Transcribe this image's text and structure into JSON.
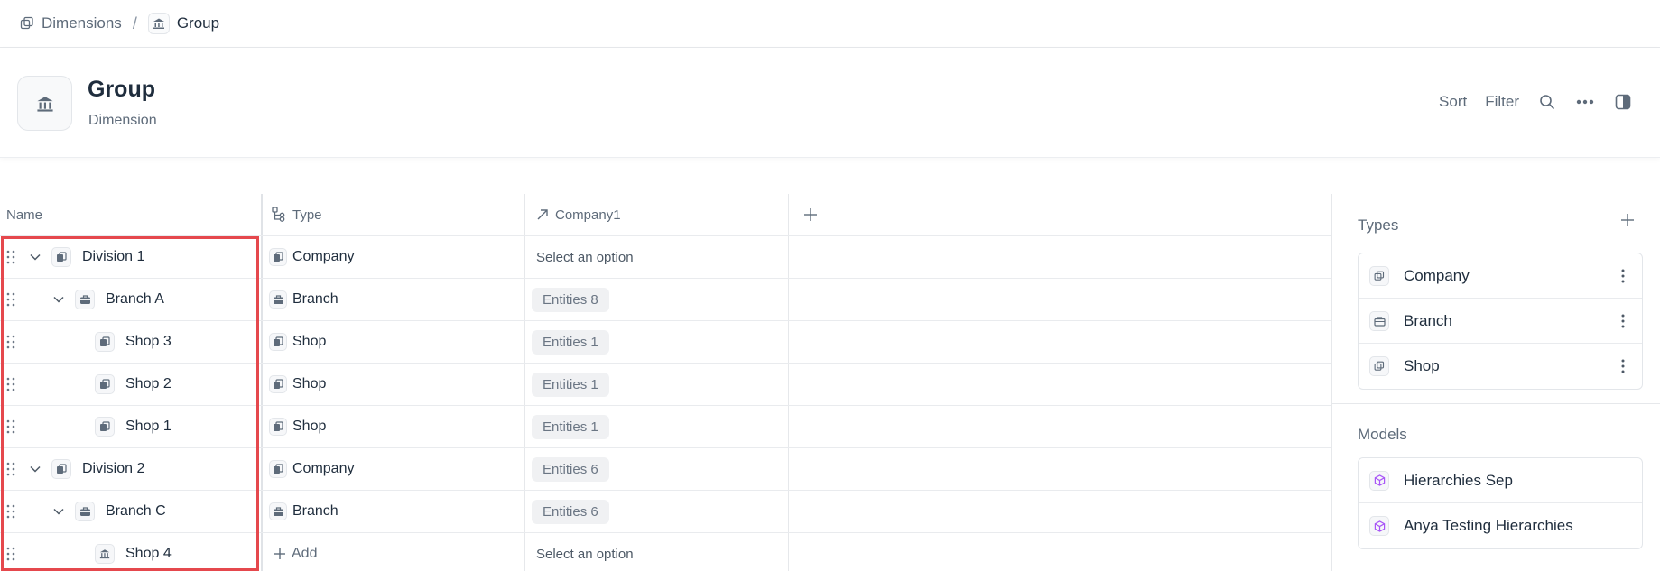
{
  "breadcrumb": {
    "root": "Dimensions",
    "separator": "/",
    "current": "Group"
  },
  "header": {
    "title": "Group",
    "subtitle": "Dimension",
    "sort": "Sort",
    "filter": "Filter"
  },
  "table": {
    "columns": {
      "name": "Name",
      "type": "Type",
      "company": "Company1"
    },
    "rows": [
      {
        "name": "Division 1",
        "type": "Company",
        "company": "Select an option"
      },
      {
        "name": "Branch A",
        "type": "Branch",
        "company": "Entities 8"
      },
      {
        "name": "Shop 3",
        "type": "Shop",
        "company": "Entities 1"
      },
      {
        "name": "Shop 2",
        "type": "Shop",
        "company": "Entities 1"
      },
      {
        "name": "Shop 1",
        "type": "Shop",
        "company": "Entities 1"
      },
      {
        "name": "Division 2",
        "type": "Company",
        "company": "Entities 6"
      },
      {
        "name": "Branch C",
        "type": "Branch",
        "company": "Entities 6"
      },
      {
        "name": "Shop 4",
        "type": "Add",
        "company": "Select an option"
      }
    ]
  },
  "sidebar": {
    "types_title": "Types",
    "types": [
      "Company",
      "Branch",
      "Shop"
    ],
    "models_title": "Models",
    "models": [
      "Hierarchies Sep",
      "Anya Testing Hierarchies"
    ]
  },
  "colors": {
    "accent_red": "#e5484d",
    "model_icon": "#a855f7",
    "text_primary": "#1f2d3d",
    "text_muted": "#5e6b7a"
  }
}
